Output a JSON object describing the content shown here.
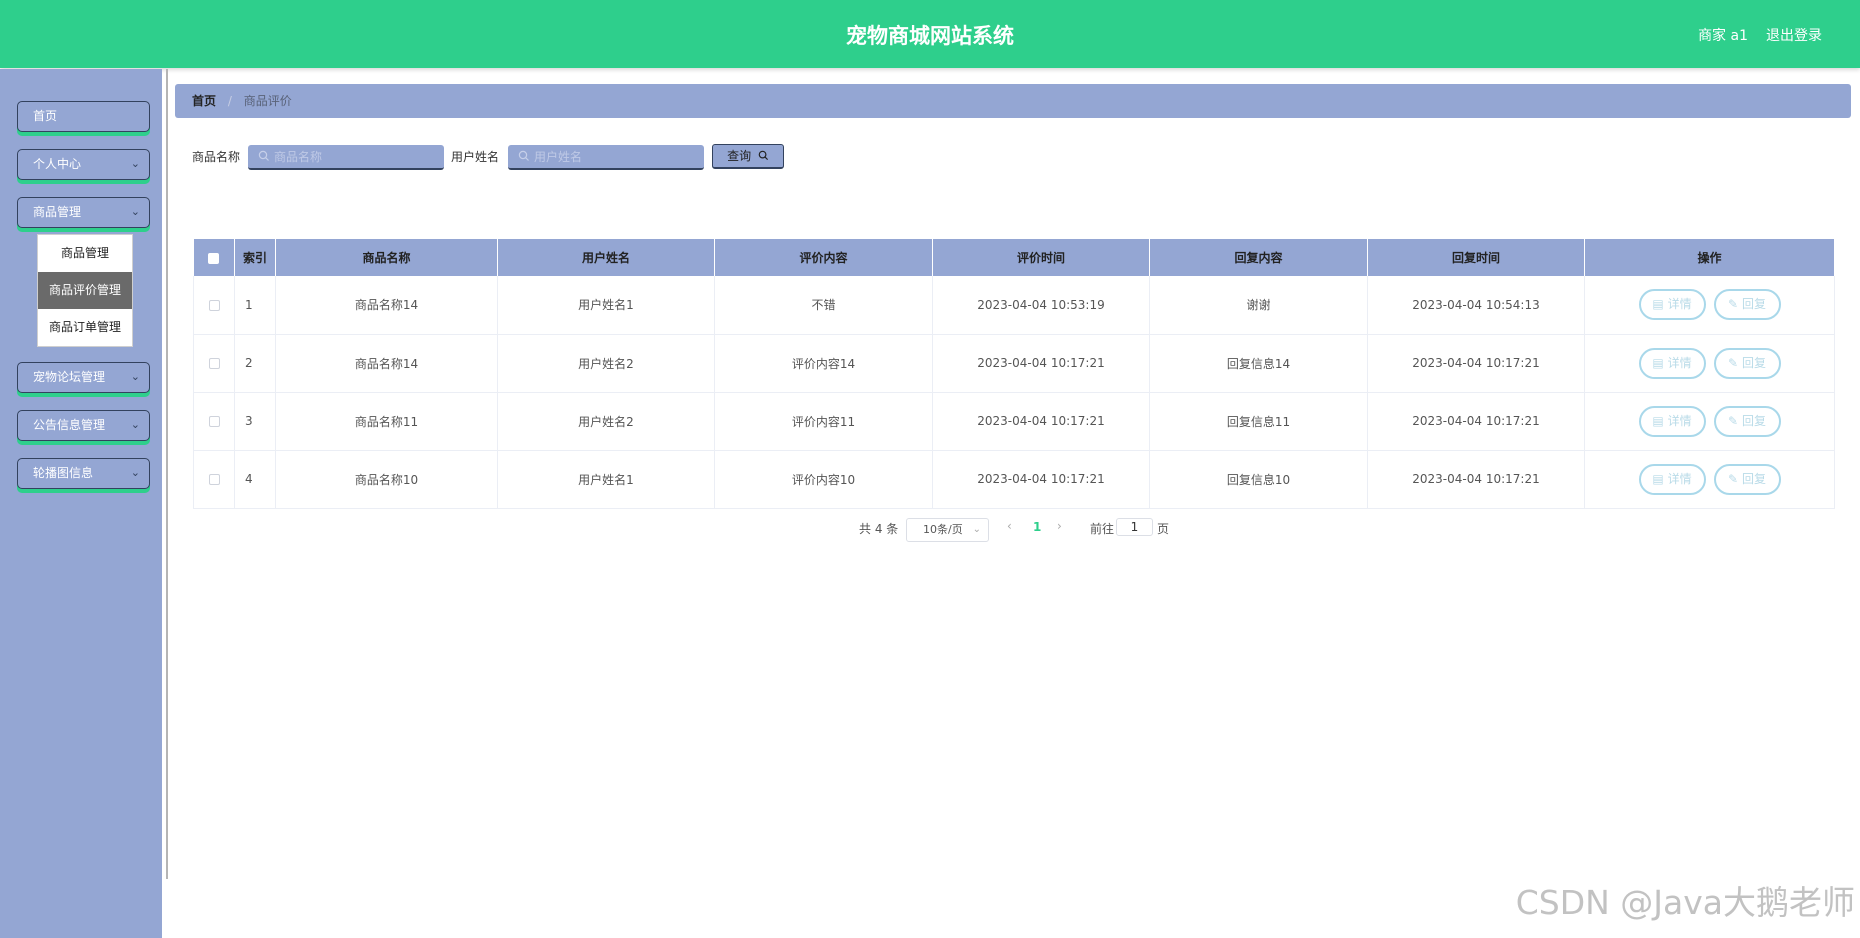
{
  "header": {
    "title": "宠物商城网站系统",
    "user_label": "商家 a1",
    "logout_label": "退出登录"
  },
  "sidebar": {
    "items": [
      {
        "label": "首页",
        "has_children": false
      },
      {
        "label": "个人中心",
        "has_children": true
      },
      {
        "label": "商品管理",
        "has_children": true,
        "expanded": true
      },
      {
        "label": "宠物论坛管理",
        "has_children": true
      },
      {
        "label": "公告信息管理",
        "has_children": true
      },
      {
        "label": "轮播图信息",
        "has_children": true
      }
    ],
    "submenu": [
      {
        "label": "商品管理",
        "active": false
      },
      {
        "label": "商品评价管理",
        "active": true
      },
      {
        "label": "商品订单管理",
        "active": false
      }
    ]
  },
  "breadcrumb": {
    "home": "首页",
    "separator": "/",
    "current": "商品评价"
  },
  "search": {
    "product_label": "商品名称",
    "product_placeholder": "商品名称",
    "user_label": "用户姓名",
    "user_placeholder": "用户姓名",
    "query_label": "查询"
  },
  "table": {
    "columns": [
      "索引",
      "商品名称",
      "用户姓名",
      "评价内容",
      "评价时间",
      "回复内容",
      "回复时间",
      "操作"
    ],
    "rows": [
      {
        "index": "1",
        "product": "商品名称14",
        "user": "用户姓名1",
        "content": "不错",
        "time": "2023-04-04 10:53:19",
        "reply": "谢谢",
        "reply_time": "2023-04-04 10:54:13"
      },
      {
        "index": "2",
        "product": "商品名称14",
        "user": "用户姓名2",
        "content": "评价内容14",
        "time": "2023-04-04 10:17:21",
        "reply": "回复信息14",
        "reply_time": "2023-04-04 10:17:21"
      },
      {
        "index": "3",
        "product": "商品名称11",
        "user": "用户姓名2",
        "content": "评价内容11",
        "time": "2023-04-04 10:17:21",
        "reply": "回复信息11",
        "reply_time": "2023-04-04 10:17:21"
      },
      {
        "index": "4",
        "product": "商品名称10",
        "user": "用户姓名1",
        "content": "评价内容10",
        "time": "2023-04-04 10:17:21",
        "reply": "回复信息10",
        "reply_time": "2023-04-04 10:17:21"
      }
    ],
    "detail_label": "详情",
    "reply_label": "回复"
  },
  "pagination": {
    "total": "共 4 条",
    "page_size": "10条/页",
    "current_page": "1",
    "goto_label": "前往",
    "goto_value": "1",
    "page_suffix": "页"
  },
  "watermark": "CSDN @Java大鹅老师",
  "colors": {
    "header": "#2ecf8c",
    "sidebar": "#94a6d3",
    "accent": "#2ecf8c",
    "dark_border": "#33425e"
  }
}
